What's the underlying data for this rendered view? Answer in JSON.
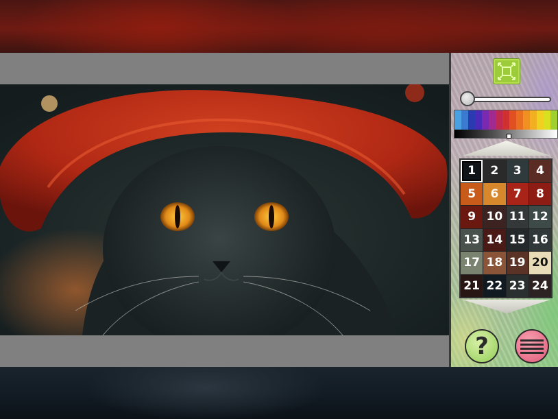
{
  "colors": {
    "game_background": "#808080",
    "fit_button": "#9ccc3a",
    "help_button": "#a8d870",
    "menu_button": "#e8708a"
  },
  "toolbar": {
    "fit_icon": "fit-to-screen-icon",
    "zoom_slider": {
      "value": 0.0
    }
  },
  "spectrum": {
    "colors": [
      "#4aa0e0",
      "#3a7ad0",
      "#2a3ab0",
      "#4a2ab8",
      "#7a2ab0",
      "#a02a90",
      "#c02a50",
      "#d03030",
      "#e05020",
      "#e87020",
      "#f09020",
      "#f0b020",
      "#f0d020",
      "#d8e020",
      "#a0d030"
    ]
  },
  "palette": {
    "selected": 1,
    "swatches": [
      {
        "num": "1",
        "color": "#0e1418",
        "dark": false
      },
      {
        "num": "2",
        "color": "#2a2a2a",
        "dark": false
      },
      {
        "num": "3",
        "color": "#2e3a3c",
        "dark": false
      },
      {
        "num": "4",
        "color": "#5a2c24",
        "dark": false
      },
      {
        "num": "5",
        "color": "#c85a1a",
        "dark": false
      },
      {
        "num": "6",
        "color": "#d8882c",
        "dark": false
      },
      {
        "num": "7",
        "color": "#a82418",
        "dark": false
      },
      {
        "num": "8",
        "color": "#8c1c14",
        "dark": false
      },
      {
        "num": "9",
        "color": "#6a1810",
        "dark": false
      },
      {
        "num": "10",
        "color": "#3c2220",
        "dark": false
      },
      {
        "num": "11",
        "color": "#343838",
        "dark": false
      },
      {
        "num": "12",
        "color": "#3e4a48",
        "dark": false
      },
      {
        "num": "13",
        "color": "#4a524e",
        "dark": false
      },
      {
        "num": "14",
        "color": "#4a1a16",
        "dark": false
      },
      {
        "num": "15",
        "color": "#24282a",
        "dark": false
      },
      {
        "num": "16",
        "color": "#30383a",
        "dark": false
      },
      {
        "num": "17",
        "color": "#7a8270",
        "dark": false
      },
      {
        "num": "18",
        "color": "#8a5438",
        "dark": false
      },
      {
        "num": "19",
        "color": "#5a3226",
        "dark": false
      },
      {
        "num": "20",
        "color": "#e8dcb8",
        "dark": true
      },
      {
        "num": "21",
        "color": "#281614",
        "dark": false
      },
      {
        "num": "22",
        "color": "#101a20",
        "dark": false
      },
      {
        "num": "23",
        "color": "#2a3030",
        "dark": false
      },
      {
        "num": "24",
        "color": "#2c2224",
        "dark": false
      }
    ]
  },
  "help": {
    "label": "?",
    "icon": "question-icon"
  },
  "menu": {
    "icon": "hamburger-menu-icon"
  }
}
